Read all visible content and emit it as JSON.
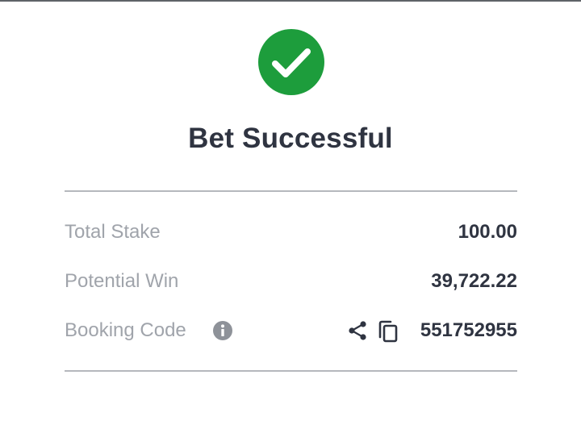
{
  "header": {
    "status_icon": "checkmark-circle-icon",
    "title": "Bet Successful",
    "accent_color": "#1d9d3c"
  },
  "summary": {
    "total_stake": {
      "label": "Total Stake",
      "value": "100.00"
    },
    "potential_win": {
      "label": "Potential Win",
      "value": "39,722.22"
    },
    "booking_code": {
      "label": "Booking Code",
      "value": "551752955",
      "info_icon": "info-icon",
      "share_icon": "share-icon",
      "copy_icon": "copy-icon"
    }
  }
}
